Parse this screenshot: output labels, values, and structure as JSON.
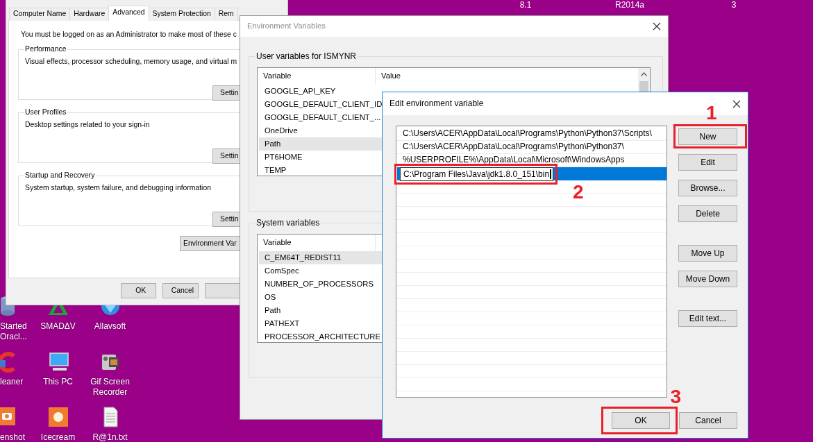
{
  "desktop": {
    "top_labels": [
      "8.1",
      "R2014a",
      "3"
    ],
    "icons": [
      {
        "kind": "database",
        "lines": [
          "Started",
          "Oracl..."
        ]
      },
      {
        "kind": "triangle",
        "lines": [
          "SMADΔV"
        ]
      },
      {
        "kind": "globe",
        "lines": [
          "Allavsoft"
        ]
      },
      {
        "kind": "brush",
        "lines": [
          "leaner"
        ]
      },
      {
        "kind": "computer",
        "lines": [
          "This PC"
        ]
      },
      {
        "kind": "camcorder",
        "lines": [
          "Gif Screen",
          "Recorder"
        ]
      },
      {
        "kind": "camera",
        "lines": [
          "enshot"
        ]
      },
      {
        "kind": "record",
        "lines": [
          "Icecream"
        ]
      },
      {
        "kind": "document",
        "lines": [
          "R@1n.txt"
        ]
      }
    ]
  },
  "system_properties": {
    "tabs": [
      {
        "label": "Computer Name",
        "selected": false
      },
      {
        "label": "Hardware",
        "selected": false
      },
      {
        "label": "Advanced",
        "selected": true
      },
      {
        "label": "System Protection",
        "selected": false
      },
      {
        "label": "Rem",
        "selected": false
      }
    ],
    "notice": "You must be logged on as an Administrator to make most of these c",
    "groups": [
      {
        "title": "Performance",
        "description": "Visual effects, processor scheduling, memory usage, and virtual m",
        "button": "Settin"
      },
      {
        "title": "User Profiles",
        "description": "Desktop settings related to your sign-in",
        "button": "Settin"
      },
      {
        "title": "Startup and Recovery",
        "description": "System startup, system failure, and debugging information",
        "button": "Settin"
      }
    ],
    "env_button": "Environment Var",
    "buttons": [
      "OK",
      "Cancel"
    ]
  },
  "environment_variables": {
    "title": "Environment Variables",
    "groups": [
      {
        "title": "User variables for ISMYNR",
        "columns": [
          "Variable",
          "Value"
        ],
        "scrollbar": true,
        "rows": [
          {
            "variable": "GOOGLE_API_KEY",
            "selected": false
          },
          {
            "variable": "GOOGLE_DEFAULT_CLIENT_ID",
            "selected": false
          },
          {
            "variable": "GOOGLE_DEFAULT_CLIENT_...",
            "selected": false
          },
          {
            "variable": "OneDrive",
            "selected": false
          },
          {
            "variable": "Path",
            "selected": true
          },
          {
            "variable": "PT6HOME",
            "selected": false
          },
          {
            "variable": "TEMP",
            "selected": false
          }
        ]
      },
      {
        "title": "System variables",
        "columns": [
          "Variable"
        ],
        "rows": [
          {
            "variable": "C_EM64T_REDIST11",
            "selected": true
          },
          {
            "variable": "ComSpec",
            "selected": false
          },
          {
            "variable": "NUMBER_OF_PROCESSORS",
            "selected": false
          },
          {
            "variable": "OS",
            "selected": false
          },
          {
            "variable": "Path",
            "selected": false
          },
          {
            "variable": "PATHEXT",
            "selected": false
          },
          {
            "variable": "PROCESSOR_ARCHITECTURE",
            "selected": false
          }
        ]
      }
    ]
  },
  "edit_dialog": {
    "title": "Edit environment variable",
    "entries": [
      {
        "value": "C:\\Users\\ACER\\AppData\\Local\\Programs\\Python\\Python37\\Scripts\\",
        "selected": false,
        "editing": false
      },
      {
        "value": "C:\\Users\\ACER\\AppData\\Local\\Programs\\Python\\Python37\\",
        "selected": false,
        "editing": false
      },
      {
        "value": "%USERPROFILE%\\AppData\\Local\\Microsoft\\WindowsApps",
        "selected": false,
        "editing": false
      },
      {
        "value": "C:\\Program Files\\Java\\jdk1.8.0_151\\bin",
        "selected": true,
        "editing": true,
        "callout": "2"
      }
    ],
    "button_groups": [
      {
        "buttons": [
          {
            "label": "New",
            "callout": "1"
          },
          {
            "label": "Edit"
          },
          {
            "label": "Browse..."
          },
          {
            "label": "Delete"
          }
        ]
      },
      {
        "buttons": [
          {
            "label": "Move Up"
          },
          {
            "label": "Move Down"
          }
        ]
      },
      {
        "buttons": [
          {
            "label": "Edit text..."
          }
        ]
      }
    ],
    "footer_buttons": [
      {
        "label": "OK",
        "callout": "3"
      },
      {
        "label": "Cancel"
      }
    ]
  }
}
